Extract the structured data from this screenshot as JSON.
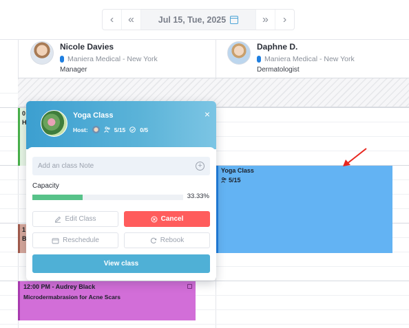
{
  "date_nav": {
    "prev_label": "‹",
    "prev_week_label": "«",
    "date_label": "Jul 15, Tue, 2025",
    "next_week_label": "»",
    "next_label": "›"
  },
  "providers": [
    {
      "name": "Nicole Davies",
      "location": "Maniera Medical - New York",
      "role": "Manager"
    },
    {
      "name": "Daphne D.",
      "location": "Maniera Medical - New York",
      "role": "Dermatologist"
    }
  ],
  "events": {
    "green_snippet": "0",
    "green_snippet2": "H",
    "brown_snippet": "1",
    "brown_snippet2": "B",
    "yoga": {
      "title": "Yoga Class",
      "count": "5/15"
    },
    "audrey": {
      "title": "12:00 PM - Audrey Black",
      "subtitle": "Microdermabrasion for Acne Scars"
    }
  },
  "popup": {
    "title": "Yoga Class",
    "host_label": "Host:",
    "attendees": "5/15",
    "checked_in": "0/5",
    "close_label": "×",
    "note_placeholder": "Add an class Note",
    "capacity_label": "Capacity",
    "capacity_percent": "33.33%",
    "capacity_fraction": 0.3333,
    "buttons": {
      "edit": "Edit Class",
      "cancel": "Cancel",
      "reschedule": "Reschedule",
      "rebook": "Rebook",
      "view": "View class"
    }
  },
  "colors": {
    "accent": "#4fb0d6",
    "cancel": "#ff5c5c",
    "yoga_event": "#63b3f3",
    "audrey_event": "#d26ed8",
    "capacity_bar": "#57c289"
  }
}
